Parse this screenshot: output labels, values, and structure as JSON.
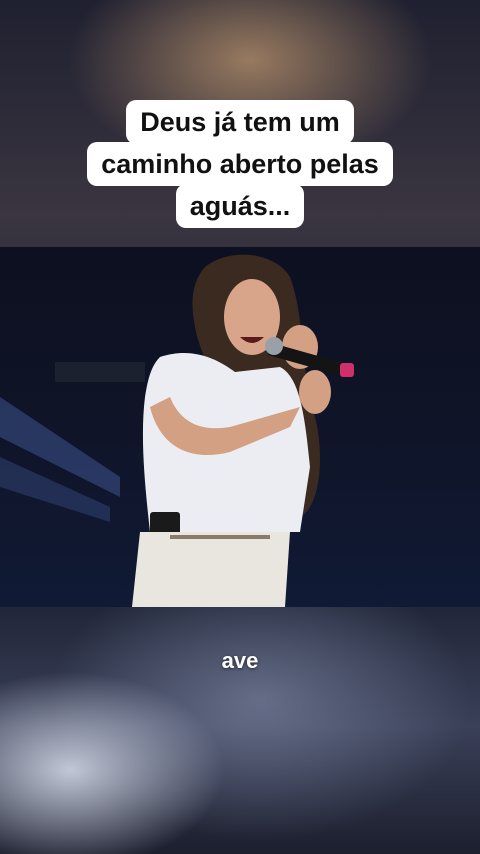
{
  "caption": {
    "lines": [
      "Deus já tem um",
      "caminho aberto pelas",
      "aguás..."
    ]
  },
  "video": {
    "description_icon": "performer-video"
  },
  "subtitle": {
    "text": "ave"
  }
}
